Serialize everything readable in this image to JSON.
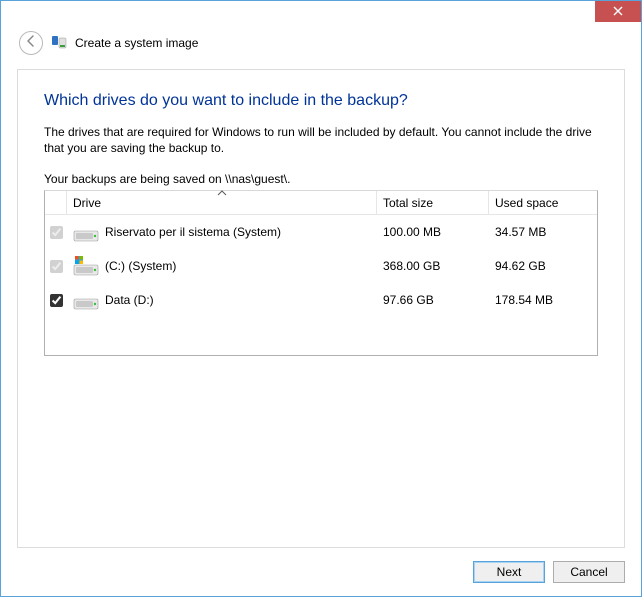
{
  "titlebar": {
    "close_icon": "close"
  },
  "header": {
    "back_icon": "arrow-left",
    "app_icon": "system-image",
    "title": "Create a system image"
  },
  "main": {
    "heading": "Which drives do you want to include in the backup?",
    "description": "The drives that are required for Windows to run will be included by default. You cannot include the drive that you are saving the backup to.",
    "saved_on_prefix": "Your backups are being saved on ",
    "saved_on_path": "\\\\nas\\guest\\",
    "saved_on_suffix": ".",
    "table": {
      "columns": {
        "drive": "Drive",
        "total_size": "Total size",
        "used_space": "Used space"
      },
      "sort_column": "drive",
      "sort_direction": "asc",
      "rows": [
        {
          "checked": true,
          "disabled": true,
          "icon": "hdd",
          "name": "Riservato per il sistema (System)",
          "total_size": "100.00 MB",
          "used_space": "34.57 MB"
        },
        {
          "checked": true,
          "disabled": true,
          "icon": "hdd-windows",
          "name": "(C:) (System)",
          "total_size": "368.00 GB",
          "used_space": "94.62 GB"
        },
        {
          "checked": true,
          "disabled": false,
          "icon": "hdd",
          "name": "Data (D:)",
          "total_size": "97.66 GB",
          "used_space": "178.54 MB"
        }
      ]
    }
  },
  "footer": {
    "next_label": "Next",
    "cancel_label": "Cancel"
  }
}
